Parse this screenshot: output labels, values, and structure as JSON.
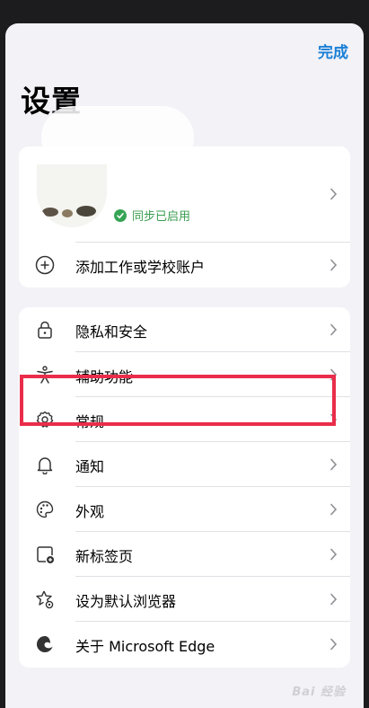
{
  "header": {
    "done_label": "完成",
    "title": "设置"
  },
  "account": {
    "sync_status": "同步已启用",
    "add_account_label": "添加工作或学校账户"
  },
  "settings": {
    "items": [
      {
        "label": "隐私和安全",
        "icon": "lock-icon"
      },
      {
        "label": "辅助功能",
        "icon": "accessibility-icon"
      },
      {
        "label": "常规",
        "icon": "gear-icon",
        "highlighted": true
      },
      {
        "label": "通知",
        "icon": "bell-icon"
      },
      {
        "label": "外观",
        "icon": "palette-icon"
      },
      {
        "label": "新标签页",
        "icon": "new-tab-icon"
      },
      {
        "label": "设为默认浏览器",
        "icon": "star-gear-icon"
      },
      {
        "label": "关于 Microsoft Edge",
        "icon": "edge-logo-icon"
      }
    ]
  },
  "watermark": "Bai 经验",
  "colors": {
    "accent": "#1b7fd6",
    "highlight": "#ea2d4a",
    "sync_green": "#35a455"
  }
}
